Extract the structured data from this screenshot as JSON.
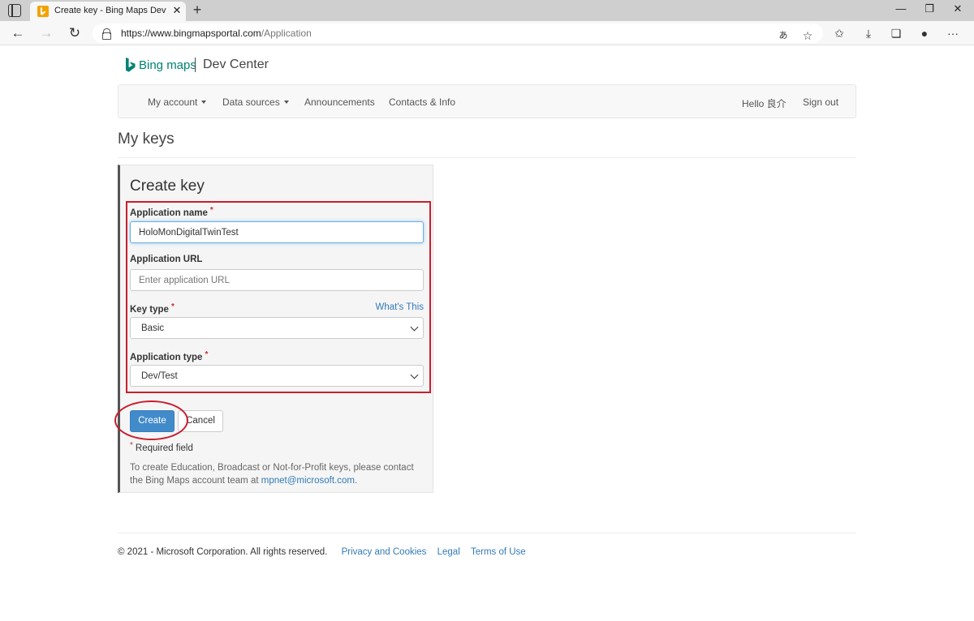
{
  "browser": {
    "tab_title": "Create key - Bing Maps Dev Center",
    "url_host": "https://www.bingmapsportal.com",
    "url_path": "/Application"
  },
  "brand": {
    "bing": "Bing maps",
    "dev_center": "Dev Center"
  },
  "nav": {
    "my_account": "My account",
    "data_sources": "Data sources",
    "announcements": "Announcements",
    "contacts": "Contacts & Info",
    "hello": "Hello 良介",
    "sign_out": "Sign out"
  },
  "page_title": "My keys",
  "form": {
    "title": "Create key",
    "app_name_label": "Application name",
    "app_name_value": "HoloMonDigitalTwinTest",
    "app_url_label": "Application URL",
    "app_url_placeholder": "Enter application URL",
    "key_type_label": "Key type",
    "whats_this": "What's This",
    "key_type_value": "Basic",
    "app_type_label": "Application type",
    "app_type_value": "Dev/Test",
    "required_mark": "*",
    "create_label": "Create",
    "cancel_label": "Cancel",
    "required_note": "Required field",
    "info_text": "To create Education, Broadcast or Not-for-Profit keys, please contact the Bing Maps account team at",
    "info_email": "mpnet@microsoft.com",
    "info_end": "."
  },
  "footer": {
    "copyright": "© 2021 - Microsoft Corporation. All rights reserved.",
    "privacy": "Privacy and Cookies",
    "legal": "Legal",
    "terms": "Terms of Use"
  },
  "colors": {
    "accent": "#428bca",
    "link": "#337ab7",
    "brand": "#008373",
    "annotation": "#c81e2e"
  }
}
